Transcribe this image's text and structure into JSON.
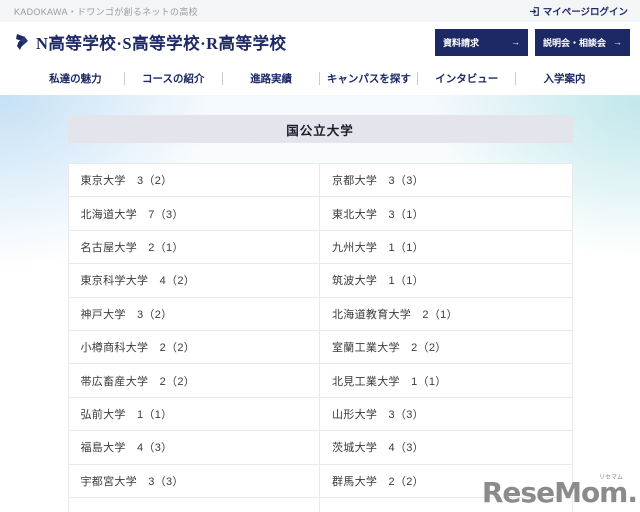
{
  "top_bar": {
    "tagline": "KADOKAWA・ドワンゴが創るネットの高校",
    "login_label": "マイページログイン"
  },
  "header": {
    "school_name": "N高等学校·S高等学校·R高等学校",
    "buttons": [
      {
        "label": "資料請求",
        "arrow": "→"
      },
      {
        "label": "説明会・相談会",
        "arrow": "→"
      }
    ]
  },
  "nav": {
    "items": [
      {
        "label": "私達の魅力"
      },
      {
        "label": "コースの紹介"
      },
      {
        "label": "進路実績"
      },
      {
        "label": "キャンパスを探す"
      },
      {
        "label": "インタビュー"
      },
      {
        "label": "入学案内"
      }
    ]
  },
  "main": {
    "section_title": "国公立大学",
    "results_table": {
      "rows": [
        [
          "東京大学　3（2）",
          "京都大学　3（3）"
        ],
        [
          "北海道大学　7（3）",
          "東北大学　3（1）"
        ],
        [
          "名古屋大学　2（1）",
          "九州大学　1（1）"
        ],
        [
          "東京科学大学　4（2）",
          "筑波大学　1（1）"
        ],
        [
          "神戸大学　3（2）",
          "北海道教育大学　2（1）"
        ],
        [
          "小樽商科大学　2（2）",
          "室蘭工業大学　2（2）"
        ],
        [
          "帯広畜産大学　2（2）",
          "北見工業大学　1（1）"
        ],
        [
          "弘前大学　1（1）",
          "山形大学　3（3）"
        ],
        [
          "福島大学　4（3）",
          "茨城大学　4（3）"
        ],
        [
          "宇都宮大学　3（3）",
          "群馬大学　2（2）"
        ]
      ]
    }
  },
  "watermark": {
    "text": "ReseMom.",
    "ruby": "リセマム"
  },
  "colors": {
    "navy": "#1d2965",
    "topbar_bg": "#f4f5f7",
    "section_title_bg": "#e4e4ed",
    "table_border": "#e9e9e9",
    "gradient_blue": "#a5d0f0",
    "gradient_teal": "#a0dce0",
    "watermark_gray": "#8b8b8b"
  }
}
